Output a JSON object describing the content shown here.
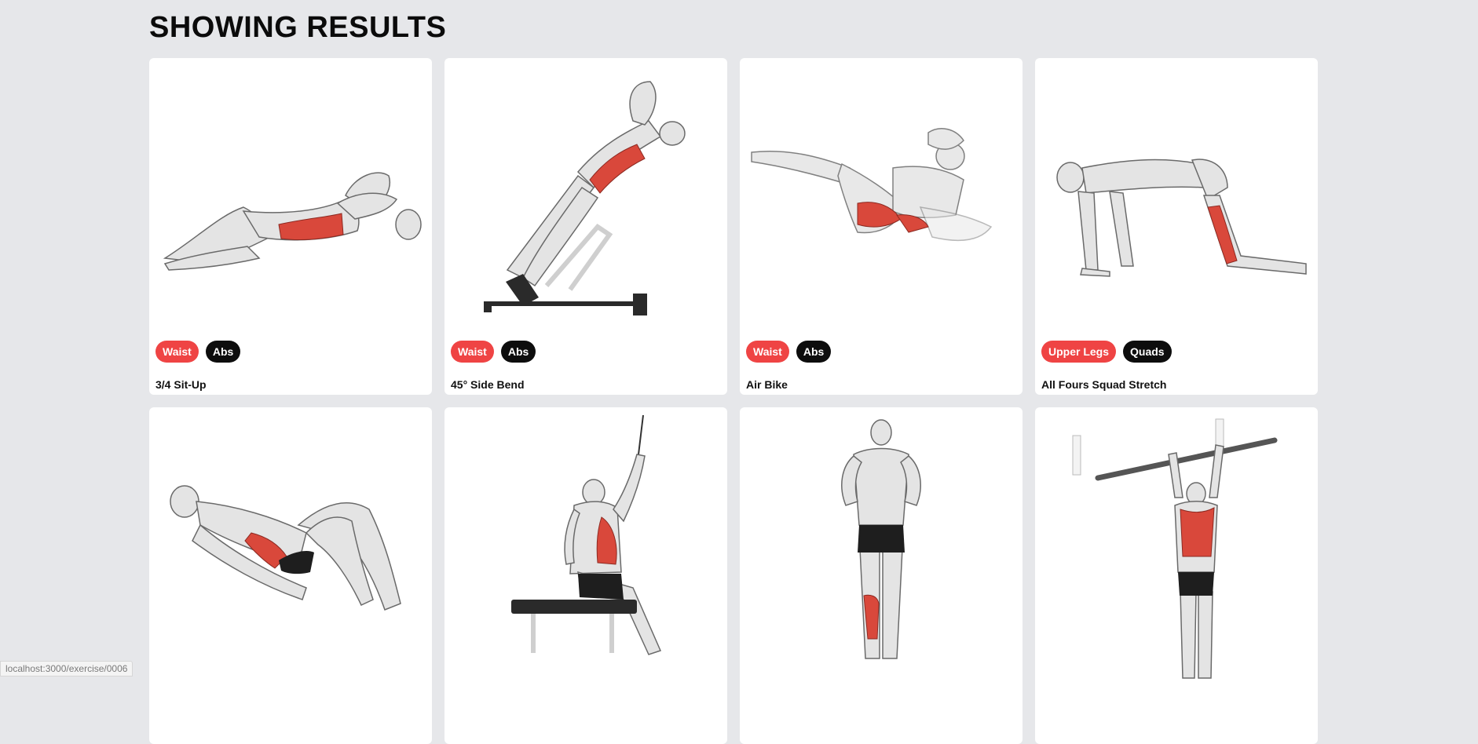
{
  "page": {
    "heading": "SHOWING RESULTS"
  },
  "exercises": [
    {
      "name": "3/4 Sit-Up",
      "body_part": "Waist",
      "target": "Abs",
      "figure": "crunch-figure"
    },
    {
      "name": "45° Side Bend",
      "body_part": "Waist",
      "target": "Abs",
      "figure": "side-bend-figure"
    },
    {
      "name": "Air Bike",
      "body_part": "Waist",
      "target": "Abs",
      "figure": "air-bike-figure"
    },
    {
      "name": "All Fours Squad Stretch",
      "body_part": "Upper Legs",
      "target": "Quads",
      "figure": "quad-stretch-figure"
    },
    {
      "figure": "reclined-crunch-figure"
    },
    {
      "figure": "cable-pulldown-figure"
    },
    {
      "figure": "standing-calf-figure"
    },
    {
      "figure": "pull-up-figure"
    }
  ],
  "status_bar": {
    "url": "localhost:3000/exercise/0006"
  },
  "colors": {
    "body_part_tag": "#ef4444",
    "target_tag": "#0d0d0d",
    "muscle_highlight": "#d9483b",
    "background": "#e6e7ea"
  }
}
